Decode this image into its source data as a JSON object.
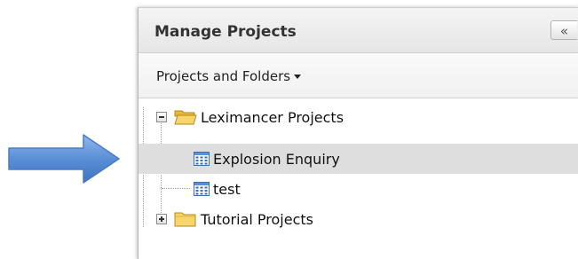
{
  "panel": {
    "title": "Manage Projects",
    "collapse_label": "«"
  },
  "toolbar": {
    "menu_label": "Projects and Folders"
  },
  "tree": {
    "nodes": [
      {
        "label": "Leximancer Projects",
        "type": "folder",
        "state": "expanded"
      },
      {
        "label": "Explosion Enquiry",
        "type": "project",
        "selected": true
      },
      {
        "label": "test",
        "type": "project",
        "selected": false
      },
      {
        "label": "Tutorial Projects",
        "type": "folder",
        "state": "collapsed"
      }
    ]
  },
  "callout": {
    "icon": "arrow-right-icon",
    "color": "#5b8fd6"
  },
  "colors": {
    "folder": "#f5cb4b",
    "selected_row": "#dedede",
    "header": "#e9e9e9"
  }
}
